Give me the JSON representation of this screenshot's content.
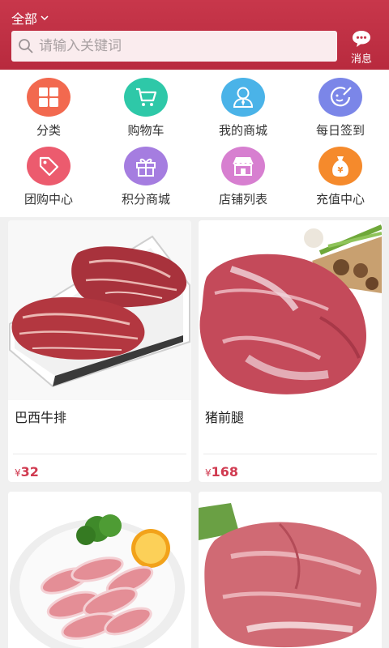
{
  "header": {
    "category_label": "全部",
    "search_placeholder": "请输入关键词",
    "message_label": "消息"
  },
  "menu": {
    "items": [
      {
        "label": "分类",
        "icon": "grid-icon",
        "color": "#f2694f"
      },
      {
        "label": "购物车",
        "icon": "cart-icon",
        "color": "#2ec8a8"
      },
      {
        "label": "我的商城",
        "icon": "user-icon",
        "color": "#4ab3e8"
      },
      {
        "label": "每日签到",
        "icon": "checkin-icon",
        "color": "#7b86e8"
      },
      {
        "label": "团购中心",
        "icon": "tag-icon",
        "color": "#ec5b6e"
      },
      {
        "label": "积分商城",
        "icon": "gift-icon",
        "color": "#a57de0"
      },
      {
        "label": "店铺列表",
        "icon": "store-icon",
        "color": "#d77fd0"
      },
      {
        "label": "充值中心",
        "icon": "moneybag-icon",
        "color": "#f58a2c"
      }
    ]
  },
  "products": [
    {
      "name": "巴西牛排",
      "currency": "¥",
      "price": "32"
    },
    {
      "name": "猪前腿",
      "currency": "¥",
      "price": "168"
    },
    {
      "name": "",
      "currency": "",
      "price": ""
    },
    {
      "name": "",
      "currency": "",
      "price": ""
    }
  ],
  "colors": {
    "brand": "#c8374b",
    "price": "#d03a50"
  }
}
